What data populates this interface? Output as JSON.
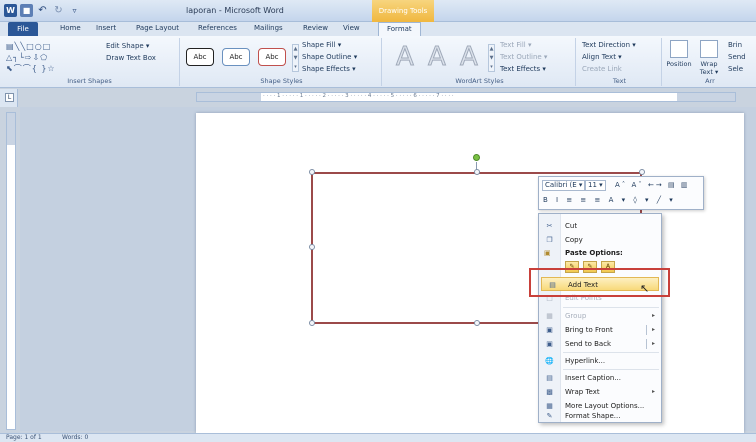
{
  "titlebar": {
    "window_title": "laporan - Microsoft Word",
    "contextual_tab": "Drawing Tools",
    "qat": {
      "word_icon": "W",
      "customize": "▿"
    }
  },
  "tabs": {
    "file": "File",
    "items": [
      "Home",
      "Insert",
      "Page Layout",
      "References",
      "Mailings",
      "Review",
      "View",
      "Format"
    ]
  },
  "ribbon": {
    "insert_shapes": {
      "label": "Insert Shapes",
      "gallery_row1": "▤╲╲□○□",
      "gallery_row2": "△┐└⇨⇩⬠",
      "gallery_row3": "⬉⌒⌒{ }☆",
      "edit_shape": "Edit Shape ▾",
      "draw_text_box": "Draw Text Box"
    },
    "shape_styles": {
      "label": "Shape Styles",
      "gallery": [
        "Abc",
        "Abc",
        "Abc"
      ],
      "shape_fill": "Shape Fill ▾",
      "shape_outline": "Shape Outline ▾",
      "shape_effects": "Shape Effects ▾"
    },
    "wordart_styles": {
      "label": "WordArt Styles",
      "letters": [
        "A",
        "A",
        "A"
      ],
      "text_fill": "Text Fill ▾",
      "text_outline": "Text Outline ▾",
      "text_effects": "Text Effects ▾"
    },
    "text": {
      "label": "Text",
      "text_direction": "Text Direction ▾",
      "align_text": "Align Text ▾",
      "create_link": "Create Link"
    },
    "arrange": {
      "label": "Arr",
      "position": "Position",
      "wrap_text": "Wrap Text ▾",
      "bring": "Brin",
      "send": "Send",
      "select": "Sele"
    }
  },
  "ruler": {
    "tab_selector": "L",
    "ticks": "· · · · 1 · · · · · 1 · · · · · 2 · · · · · 3 · · · · · 4 · · · · · 5 · · · · · 6 · · · · · 7 · · · ·"
  },
  "mini_toolbar": {
    "font": "Calibri (E ▾",
    "size": "11 ▾",
    "row1_tools": "Aˆ Aˇ ←→ ▤ ▥",
    "row2_tools": "B I ≡ ≡ ≡ A ▾ ◊ ▾ ╱ ▾"
  },
  "context_menu": {
    "cut": "Cut",
    "copy": "Copy",
    "paste_options": "Paste Options:",
    "add_text": "Add Text",
    "edit_points": "Edit Points",
    "group": "Group",
    "bring_to_front": "Bring to Front",
    "send_to_back": "Send to Back",
    "hyperlink": "Hyperlink...",
    "insert_caption": "Insert Caption...",
    "wrap_text": "Wrap Text",
    "more_layout_options": "More Layout Options...",
    "format_shape": "Format Shape..."
  },
  "statusbar": {
    "page": "Page: 1 of 1",
    "words": "Words: 0"
  },
  "colors": {
    "highlight_box": "#c8403a",
    "menu_highlight": "#f8d97a",
    "shape_outline": "#9b4a4a",
    "rotation_handle": "#7ac143"
  }
}
